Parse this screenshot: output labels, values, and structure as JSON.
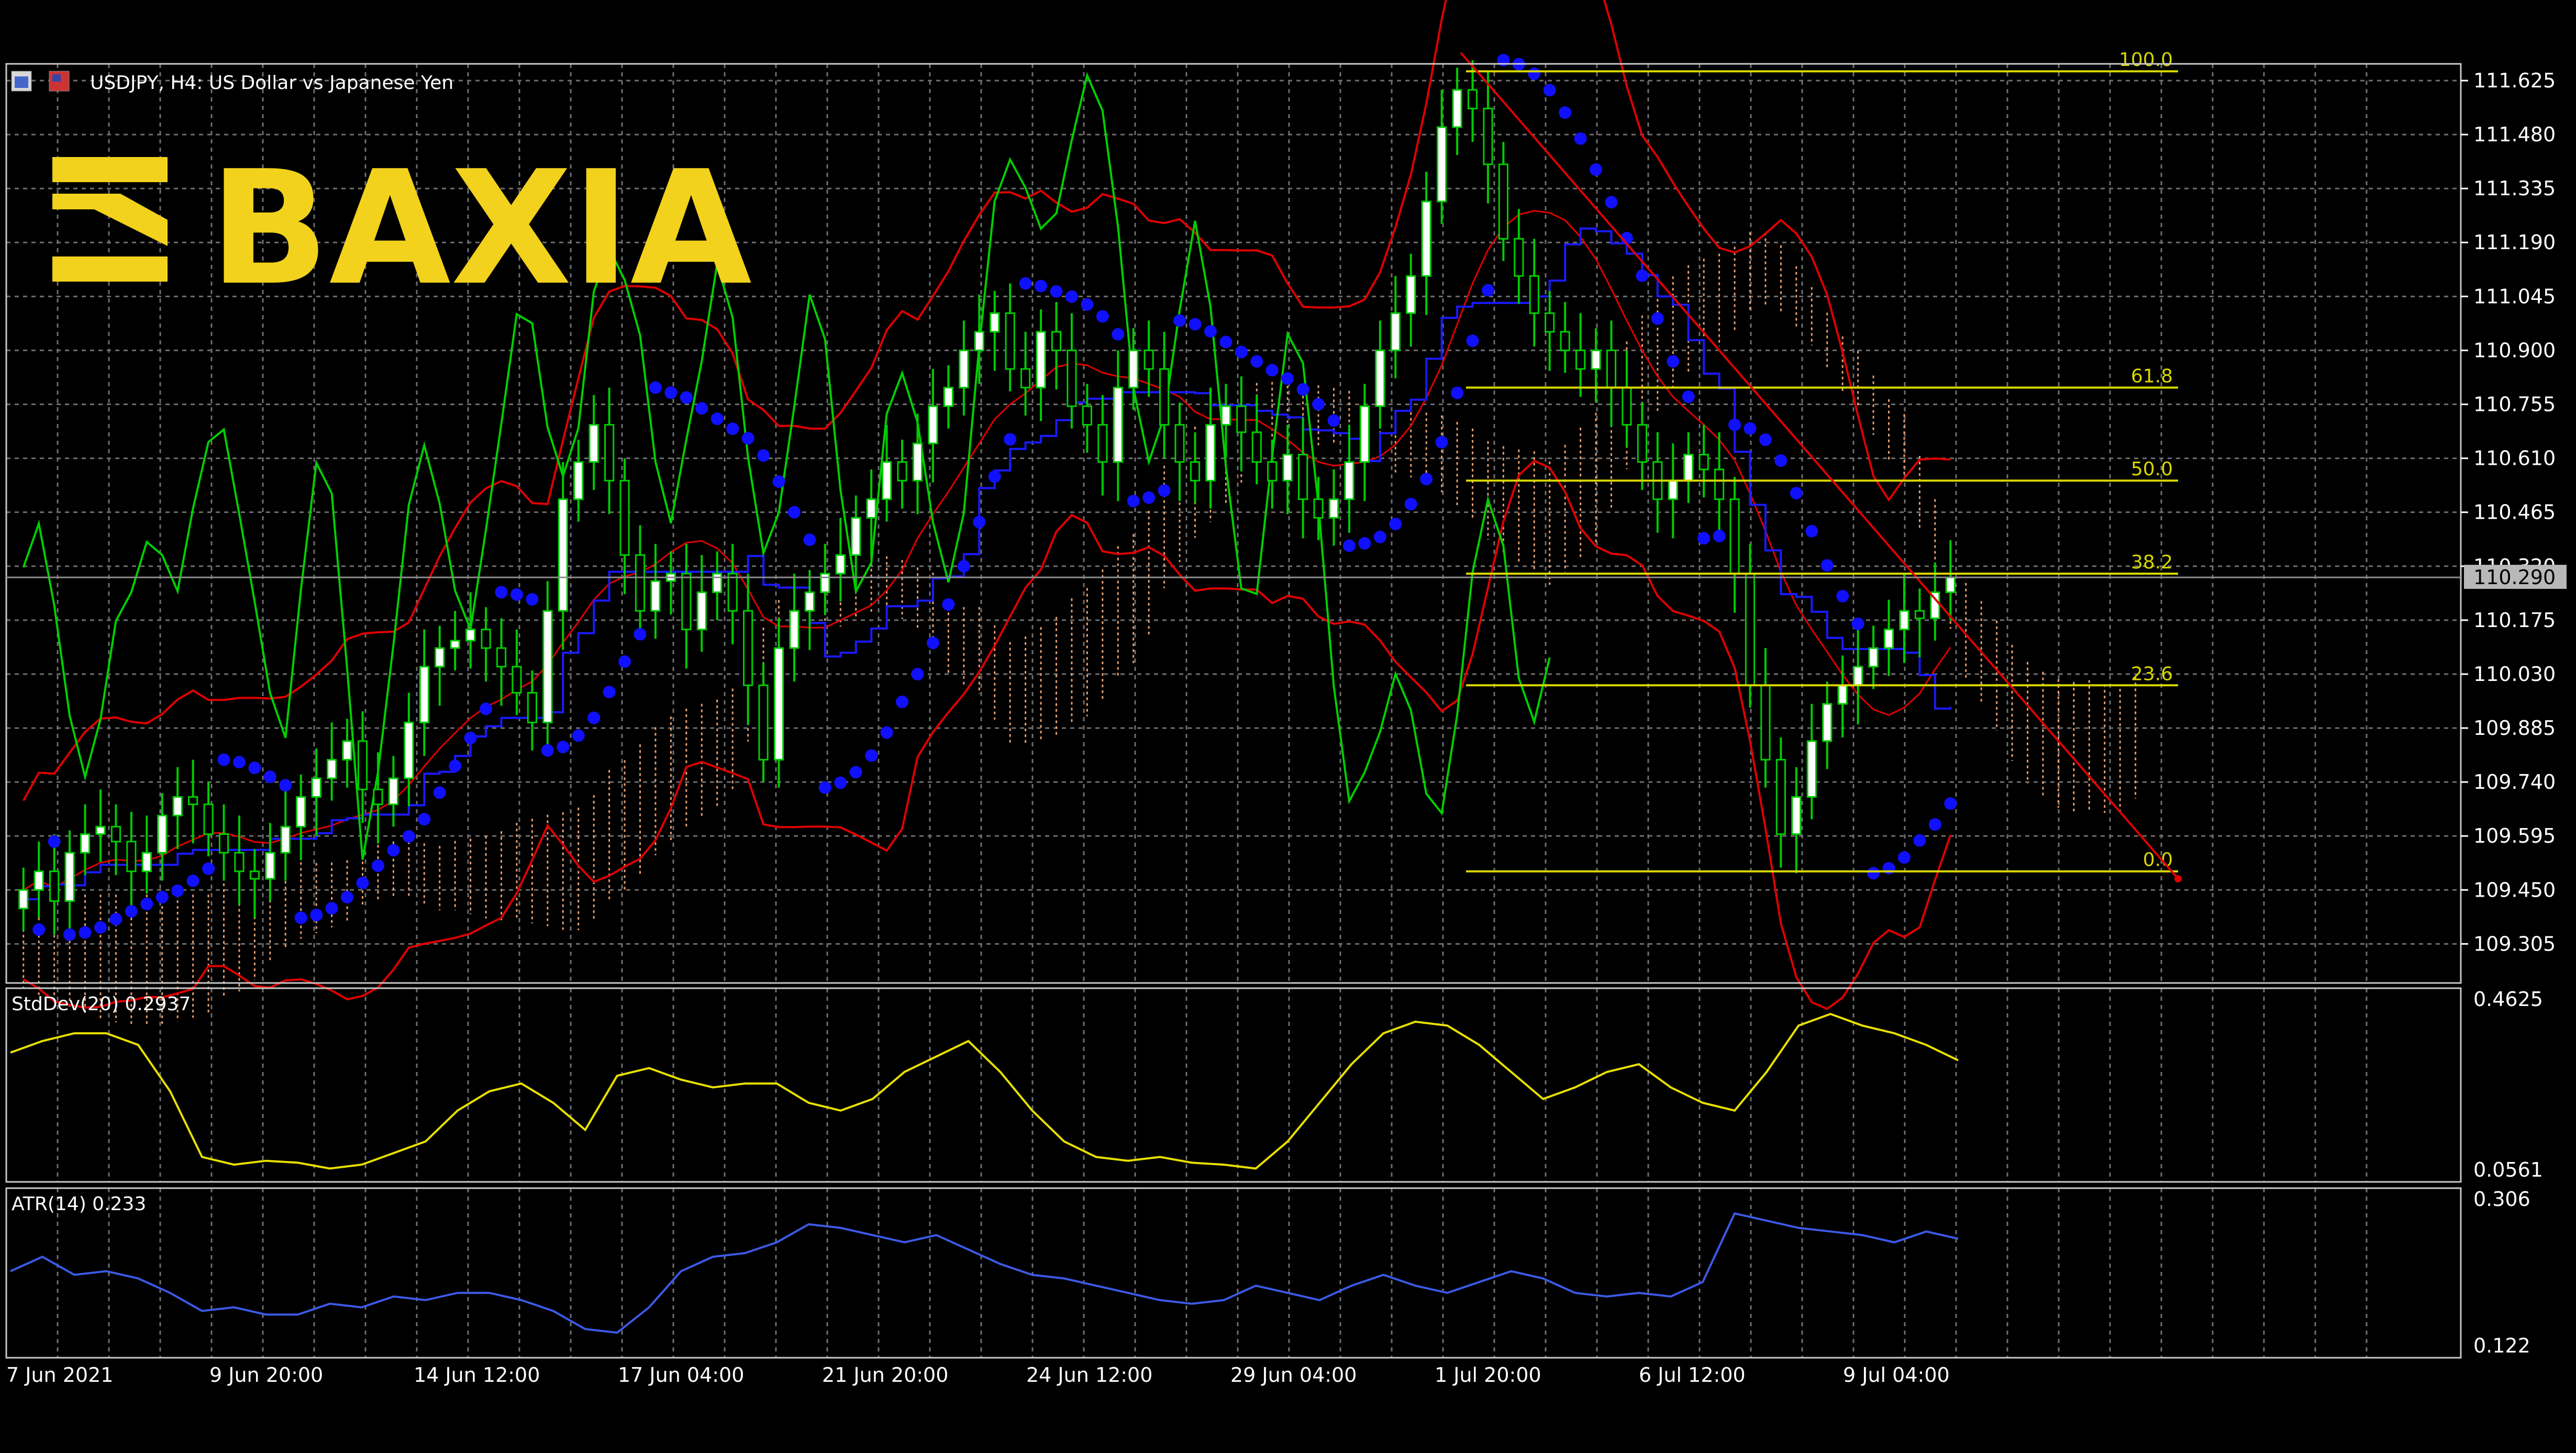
{
  "window": {
    "symbol_label": "USDJPY, H4:  US Dollar vs Japanese Yen",
    "brand": "BAXIA"
  },
  "colors": {
    "background": "#000000",
    "grid": "#6e6e6e",
    "axis_text": "#ffffff",
    "bull_candle": "#ffffff",
    "bear_candle": "#000000",
    "candle_wick": "#00cc00",
    "bollinger": "#e00000",
    "parabolic_sar": "#1010ff",
    "ichimoku_kijun": "#1a1aff",
    "ichimoku_chikou": "#00d000",
    "ichimoku_cloud": "#e8a070",
    "fibonacci": "#d8d800",
    "trendline": "#e00000",
    "stddev_line": "#e8e000",
    "atr_line": "#3c5ae6",
    "brand": "#f2d21c",
    "price_tag_bg": "#b8b8b8"
  },
  "chart_data": [
    {
      "type": "line",
      "panel": "main",
      "subtype": "candlestick",
      "title": "USDJPY, H4:  US Dollar vs Japanese Yen",
      "y_ticks": [
        "111.625",
        "111.480",
        "111.335",
        "111.190",
        "111.045",
        "110.900",
        "110.755",
        "110.610",
        "110.465",
        "110.320",
        "110.175",
        "110.030",
        "109.885",
        "109.740",
        "109.595",
        "109.450",
        "109.305"
      ],
      "ylim": [
        109.2,
        111.67
      ],
      "current_price": "110.290",
      "x_ticks": [
        "7 Jun 2021",
        "9 Jun 20:00",
        "14 Jun 12:00",
        "17 Jun 04:00",
        "21 Jun 20:00",
        "24 Jun 12:00",
        "29 Jun 04:00",
        "1 Jul 20:00",
        "6 Jul 12:00",
        "9 Jul 04:00"
      ],
      "close_series": [
        109.45,
        109.5,
        109.42,
        109.55,
        109.6,
        109.62,
        109.58,
        109.5,
        109.55,
        109.65,
        109.7,
        109.68,
        109.6,
        109.55,
        109.5,
        109.48,
        109.55,
        109.62,
        109.7,
        109.75,
        109.8,
        109.85,
        109.72,
        109.68,
        109.75,
        109.9,
        110.05,
        110.1,
        110.12,
        110.15,
        110.1,
        110.05,
        109.98,
        109.9,
        110.2,
        110.5,
        110.6,
        110.7,
        110.55,
        110.35,
        110.2,
        110.28,
        110.3,
        110.15,
        110.25,
        110.3,
        110.2,
        110.0,
        109.8,
        110.1,
        110.2,
        110.25,
        110.3,
        110.35,
        110.45,
        110.5,
        110.6,
        110.55,
        110.65,
        110.75,
        110.8,
        110.9,
        110.95,
        111.0,
        110.85,
        110.8,
        110.95,
        110.9,
        110.75,
        110.7,
        110.6,
        110.8,
        110.9,
        110.85,
        110.7,
        110.6,
        110.55,
        110.7,
        110.75,
        110.68,
        110.6,
        110.55,
        110.62,
        110.5,
        110.45,
        110.5,
        110.6,
        110.75,
        110.9,
        111.0,
        111.1,
        111.3,
        111.5,
        111.6,
        111.55,
        111.4,
        111.2,
        111.1,
        111.0,
        110.95,
        110.9,
        110.85,
        110.9,
        110.8,
        110.7,
        110.6,
        110.5,
        110.55,
        110.62,
        110.58,
        110.5,
        110.3,
        110.0,
        109.8,
        109.6,
        109.7,
        109.85,
        109.95,
        110.0,
        110.05,
        110.1,
        110.15,
        110.2,
        110.18,
        110.25,
        110.29
      ],
      "fibonacci_levels": [
        {
          "label": "100.0",
          "value": 111.65
        },
        {
          "label": "61.8",
          "value": 110.8
        },
        {
          "label": "50.0",
          "value": 110.55
        },
        {
          "label": "38.2",
          "value": 110.3
        },
        {
          "label": "23.6",
          "value": 110.0
        },
        {
          "label": "0.0",
          "value": 109.5
        }
      ]
    },
    {
      "type": "line",
      "panel": "indicator",
      "title": "StdDev(20) 0.2937",
      "ylim": [
        0.0561,
        0.4625
      ],
      "y_ticks": [
        "0.4625",
        "0.0561"
      ],
      "values": [
        0.35,
        0.38,
        0.4,
        0.4,
        0.37,
        0.25,
        0.08,
        0.06,
        0.07,
        0.065,
        0.05,
        0.06,
        0.09,
        0.12,
        0.2,
        0.25,
        0.27,
        0.22,
        0.15,
        0.29,
        0.31,
        0.28,
        0.26,
        0.27,
        0.27,
        0.22,
        0.2,
        0.23,
        0.3,
        0.34,
        0.38,
        0.3,
        0.2,
        0.12,
        0.08,
        0.07,
        0.08,
        0.065,
        0.06,
        0.05,
        0.12,
        0.22,
        0.32,
        0.4,
        0.43,
        0.42,
        0.37,
        0.3,
        0.23,
        0.26,
        0.3,
        0.32,
        0.26,
        0.22,
        0.2,
        0.3,
        0.42,
        0.45,
        0.42,
        0.4,
        0.37,
        0.33
      ]
    },
    {
      "type": "line",
      "panel": "indicator",
      "title": "ATR(14) 0.233",
      "ylim": [
        0.122,
        0.306
      ],
      "y_ticks": [
        "0.306",
        "0.122"
      ],
      "values": [
        0.22,
        0.24,
        0.215,
        0.22,
        0.21,
        0.19,
        0.165,
        0.17,
        0.16,
        0.16,
        0.175,
        0.17,
        0.185,
        0.18,
        0.19,
        0.19,
        0.18,
        0.165,
        0.14,
        0.135,
        0.17,
        0.22,
        0.24,
        0.245,
        0.26,
        0.285,
        0.28,
        0.27,
        0.26,
        0.27,
        0.25,
        0.23,
        0.215,
        0.21,
        0.2,
        0.19,
        0.18,
        0.175,
        0.18,
        0.2,
        0.19,
        0.18,
        0.2,
        0.215,
        0.2,
        0.19,
        0.205,
        0.22,
        0.21,
        0.19,
        0.185,
        0.19,
        0.185,
        0.205,
        0.3,
        0.29,
        0.28,
        0.275,
        0.27,
        0.26,
        0.275,
        0.265
      ]
    }
  ]
}
